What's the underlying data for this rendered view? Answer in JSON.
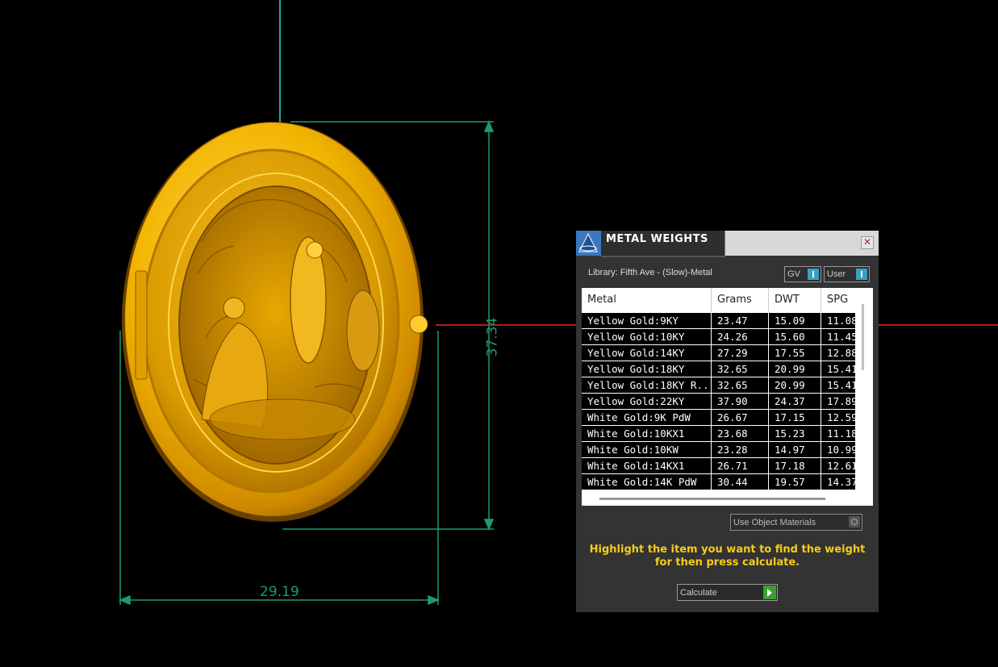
{
  "viewport": {
    "dimension_width": "29.19",
    "dimension_height": "37.34",
    "colors": {
      "dimension_lines": "#1f9a6a",
      "axis_vertical": "#22a0a8",
      "axis_horizontal": "#b02010",
      "gold": "#f0b000"
    }
  },
  "panel": {
    "title": "METAL WEIGHTS",
    "close_icon": "close-icon",
    "library_label": "Library: Fifth Ave - (Slow)-Metal",
    "toggle_gv_label": "GV",
    "toggle_user_label": "User",
    "table": {
      "columns": [
        "Metal",
        "Grams",
        "DWT",
        "SPG"
      ],
      "rows": [
        [
          "Yellow Gold:9KY",
          "23.47",
          "15.09",
          "11.08"
        ],
        [
          "Yellow Gold:10KY",
          "24.26",
          "15.60",
          "11.45"
        ],
        [
          "Yellow Gold:14KY",
          "27.29",
          "17.55",
          "12.88"
        ],
        [
          "Yellow Gold:18KY",
          "32.65",
          "20.99",
          "15.41"
        ],
        [
          "Yellow Gold:18KY R...",
          "32.65",
          "20.99",
          "15.41"
        ],
        [
          "Yellow Gold:22KY",
          "37.90",
          "24.37",
          "17.89"
        ],
        [
          "White Gold:9K PdW",
          "26.67",
          "17.15",
          "12.59"
        ],
        [
          "White Gold:10KX1",
          "23.68",
          "15.23",
          "11.18"
        ],
        [
          "White Gold:10KW",
          "23.28",
          "14.97",
          "10.99"
        ],
        [
          "White Gold:14KX1",
          "26.71",
          "17.18",
          "12.61"
        ],
        [
          "White Gold:14K PdW",
          "30.44",
          "19.57",
          "14.37"
        ]
      ]
    },
    "use_object_label": "Use Object Materials",
    "instruction": "Highlight the item you want to find the weight for then press calculate.",
    "calculate_label": "Calculate"
  }
}
